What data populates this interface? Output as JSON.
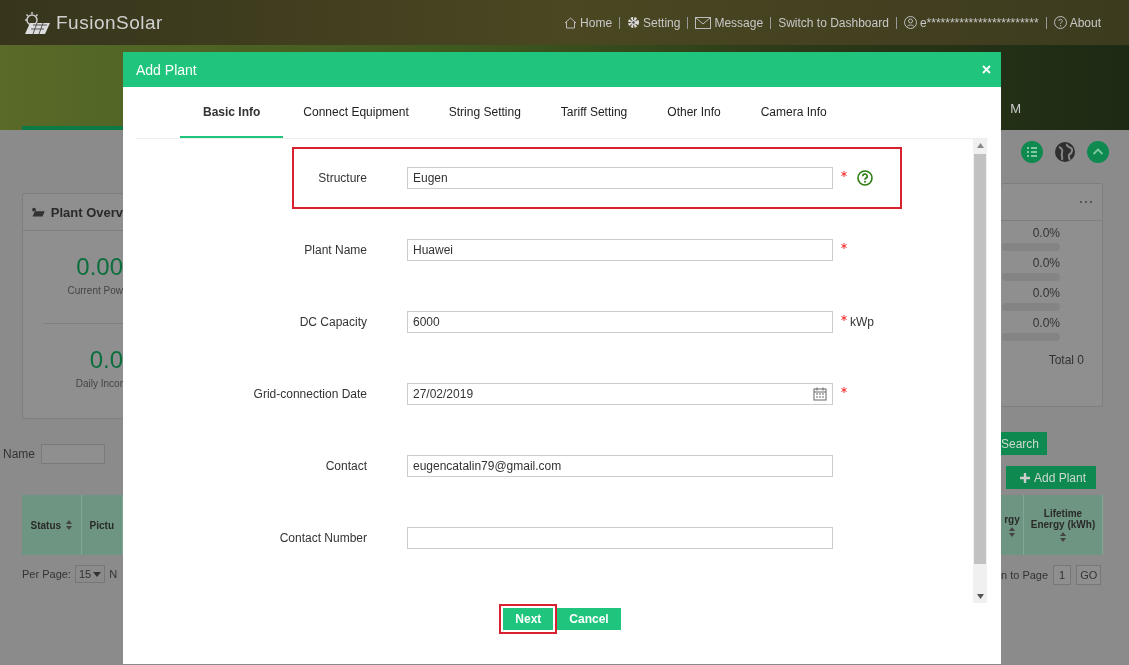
{
  "app": {
    "logo": "FusionSolar",
    "banner_text": "M",
    "nav": [
      {
        "kind": "home",
        "label": "Home"
      },
      {
        "kind": "setting",
        "label": "Setting"
      },
      {
        "kind": "message",
        "label": "Message"
      },
      {
        "kind": "plain",
        "label": "Switch to Dashboard"
      },
      {
        "kind": "user",
        "label": "e************************"
      },
      {
        "kind": "about",
        "label": "About"
      }
    ]
  },
  "left_panel": {
    "overview_title": "Plant Overv",
    "stats": [
      {
        "value": "0.00",
        "label": "Current Pow"
      },
      {
        "value": "0.0",
        "label": "Daily Incor"
      }
    ],
    "search_label": "Name",
    "columns": [
      {
        "label": "Status",
        "sortable": true
      },
      {
        "label": "Pictu",
        "sortable": false
      }
    ],
    "per_page_label": "Per Page:",
    "per_page": "15",
    "pager_text": "N"
  },
  "right_panel": {
    "shares": [
      {
        "reading": "0.0%",
        "level": 0
      },
      {
        "reading": "0.0%",
        "level": 0
      },
      {
        "reading": "0.0%",
        "level": 0
      },
      {
        "reading": "0.0%",
        "level": 0
      }
    ],
    "total": "Total 0",
    "search_button": "Search",
    "add_button": "Add Plant",
    "columns": [
      {
        "label": "rgy",
        "sortable": true
      },
      {
        "label": "Lifetime Energy (kWh)",
        "sortable": true
      }
    ],
    "jump_label": "n to Page",
    "page": "1",
    "go_button": "GO"
  },
  "dialog": {
    "title": "Add Plant",
    "tabs": [
      {
        "label": "Basic Info",
        "selected": true
      },
      {
        "label": "Connect Equipment",
        "selected": false
      },
      {
        "label": "String Setting",
        "selected": false
      },
      {
        "label": "Tariff Setting",
        "selected": false
      },
      {
        "label": "Other Info",
        "selected": false
      },
      {
        "label": "Camera Info",
        "selected": false
      }
    ],
    "fields": [
      {
        "kind": "text",
        "label": "Structure",
        "value": "Eugen",
        "required": true,
        "help": true,
        "highlighted": true
      },
      {
        "kind": "text",
        "label": "Plant Name",
        "value": "Huawei",
        "required": true,
        "help": false,
        "highlighted": false
      },
      {
        "kind": "text",
        "label": "DC Capacity",
        "value": "6000",
        "required": true,
        "unit": "kWp",
        "help": false,
        "highlighted": false
      },
      {
        "kind": "date",
        "label": "Grid-connection Date",
        "value": "27/02/2019",
        "required": true,
        "help": false,
        "highlighted": false
      },
      {
        "kind": "text",
        "label": "Contact",
        "value": "eugencatalin79@gmail.com",
        "required": false,
        "help": false,
        "highlighted": false
      },
      {
        "kind": "text",
        "label": "Contact Number",
        "required": false,
        "help": false,
        "highlighted": false
      }
    ],
    "buttons": [
      {
        "label": "Next",
        "highlighted": true
      },
      {
        "label": "Cancel",
        "highlighted": false
      }
    ]
  }
}
